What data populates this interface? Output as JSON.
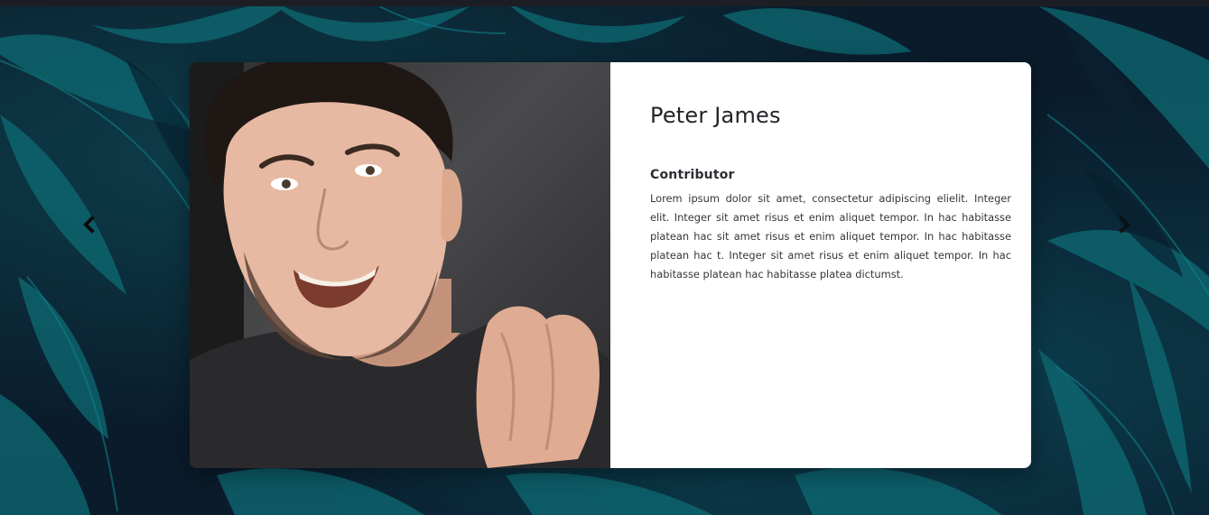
{
  "profile": {
    "name": "Peter James",
    "role": "Contributor",
    "bio": "Lorem ipsum dolor sit amet, consectetur adipiscing elielit. Integer elit. Integer sit amet risus et enim aliquet tempor. In hac habitasse platean hac sit amet risus et enim aliquet tempor. In hac habitasse platean hac t. Integer sit amet risus et enim aliquet tempor. In hac habitasse platean hac habitasse platea dictumst.",
    "photo_alt": "Portrait photo of smiling man"
  },
  "carousel": {
    "prev_icon": "chevron-left-icon",
    "next_icon": "chevron-right-icon"
  },
  "colors": {
    "background": "#0a1b2b",
    "leaf_teal": "#0e6b74",
    "card_bg": "#ffffff",
    "name_text": "#222428",
    "body_text": "#33363b"
  }
}
